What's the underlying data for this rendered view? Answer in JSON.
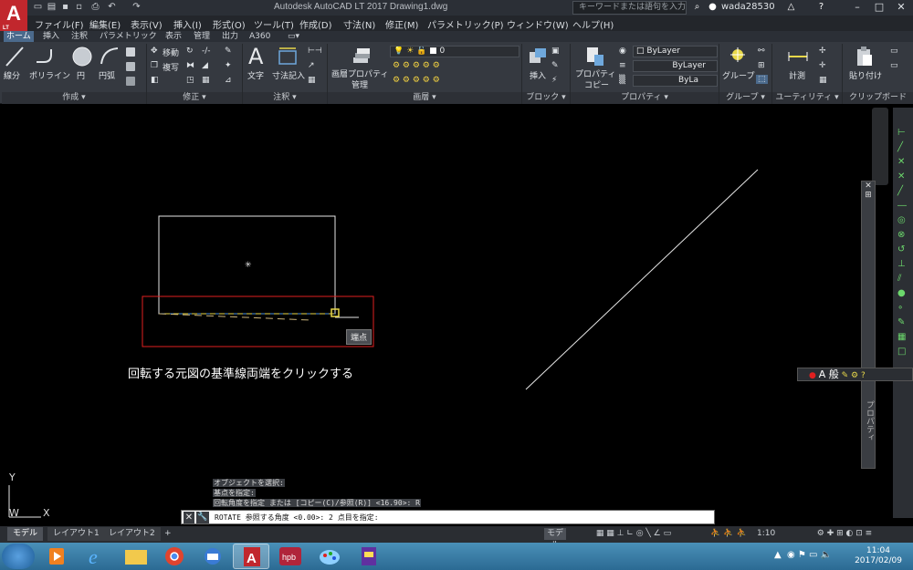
{
  "app": {
    "logo_letter": "A",
    "logo_sub": "LT",
    "title": "Autodesk AutoCAD LT 2017    Drawing1.dwg",
    "search_placeholder": "キーワードまたは語句を入力",
    "user": "wada28530"
  },
  "menu": [
    "ファイル(F)",
    "編集(E)",
    "表示(V)",
    "挿入(I)",
    "形式(O)",
    "ツール(T)",
    "作成(D)",
    "寸法(N)",
    "修正(M)",
    "パラメトリック(P)",
    "ウィンドウ(W)",
    "ヘルプ(H)"
  ],
  "ribbon_tabs": [
    "ホーム",
    "挿入",
    "注釈",
    "パラメトリック",
    "表示",
    "管理",
    "出力",
    "A360"
  ],
  "ribbon": {
    "draw": {
      "line": "線分",
      "polyline": "ポリライン",
      "circle": "円",
      "arc": "円弧",
      "title": "作成 ▾"
    },
    "modify": {
      "move": "移動",
      "copy": "複写",
      "title": "修正 ▾"
    },
    "annotation": {
      "text": "文字",
      "dimension": "寸法記入",
      "title": "注釈 ▾"
    },
    "layers": {
      "props_label1": "画層プロパティ",
      "props_label2": "管理",
      "layer_value": "0",
      "title": "画層 ▾"
    },
    "block": {
      "insert": "挿入",
      "title": "ブロック ▾"
    },
    "properties": {
      "label1": "プロパティ",
      "label2": "コピー",
      "color": "ByLayer",
      "linetype": "ByLayer",
      "lineweight": "ByLa",
      "title": "プロパティ ▾"
    },
    "groups": {
      "group": "グループ",
      "title": "グループ ▾"
    },
    "utilities": {
      "measure": "計測",
      "title": "ユーティリティ ▾"
    },
    "clipboard": {
      "paste": "貼り付け",
      "title": "クリップボード"
    }
  },
  "drawing": {
    "tooltip": "端点",
    "instruction": "回転する元図の基準線両端をクリックする",
    "ucs_y": "Y",
    "ucs_w": "W",
    "ucs_x": "X"
  },
  "properties_palette_label": "プロパティ",
  "ime": {
    "text": "A 般"
  },
  "command": {
    "history": [
      "オブジェクトを選択:",
      "基点を指定:",
      "回転角度を指定 または [コピー(C)/参照(R)] <16.90>: R"
    ],
    "prompt": "ROTATE 参照する角度 <0.00>:  2 点目を指定:"
  },
  "layout_tabs": [
    "モデル",
    "レイアウト1",
    "レイアウト2",
    "+"
  ],
  "status": {
    "model": "モデル",
    "scale": "1:10"
  },
  "taskbar": {
    "time": "11:04",
    "date": "2017/02/09"
  },
  "colors": {
    "accent_red": "#c1272d",
    "selection_box": "#e02020",
    "snap_marker": "#e8d84a"
  }
}
